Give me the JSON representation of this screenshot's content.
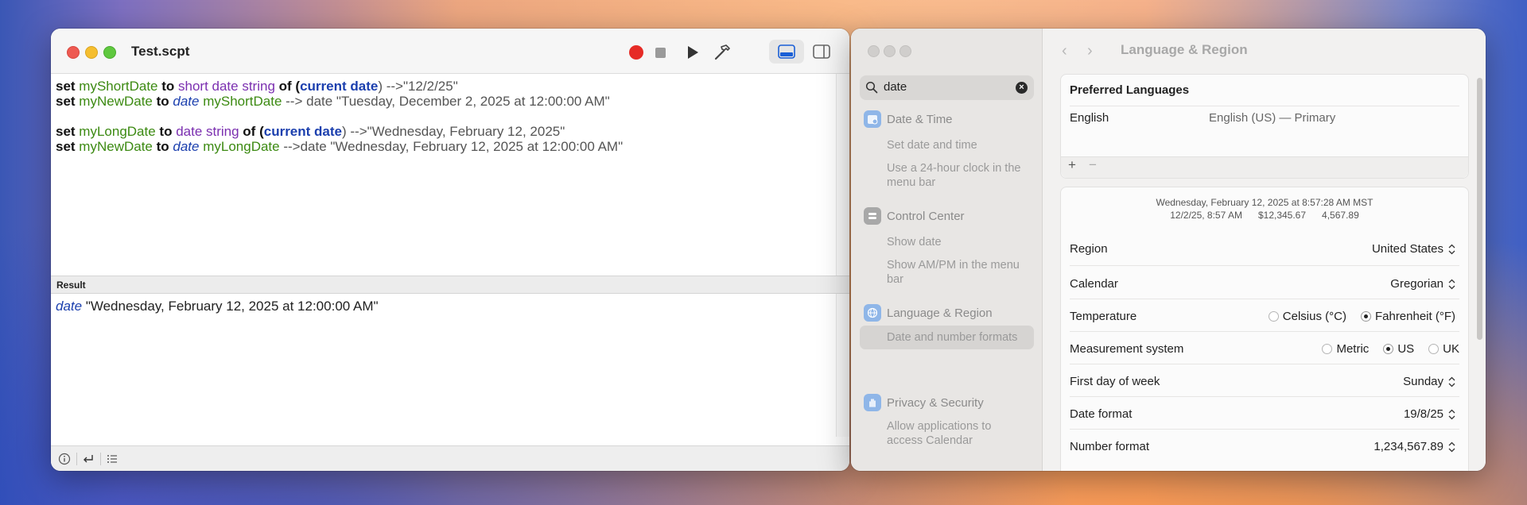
{
  "script_window": {
    "title": "Test.scpt",
    "toolbar": {
      "record": "record-icon",
      "stop": "stop-icon",
      "run": "play-icon",
      "compile": "hammer-icon",
      "view_bottom": "panel-bottom-icon",
      "view_side": "panel-side-icon"
    },
    "code": {
      "l1": {
        "a": "set ",
        "b": "myShortDate",
        "c": " to ",
        "d": "short date string",
        "e": " of (",
        "f": "current date",
        "g": ") -->\"12/2/25\""
      },
      "l2": {
        "a": "set ",
        "b": "myNewDate",
        "c": " to ",
        "d": "date",
        "e": " ",
        "f": "myShortDate",
        "g": " --> date \"Tuesday, December 2, 2025 at 12:00:00 AM\""
      },
      "l3": {
        "a": "set ",
        "b": "myLongDate",
        "c": " to ",
        "d": "date string",
        "e": " of (",
        "f": "current date",
        "g": ") -->\"Wednesday, February 12, 2025\""
      },
      "l4": {
        "a": "set ",
        "b": "myNewDate",
        "c": " to ",
        "d": "date",
        "e": " ",
        "f": "myLongDate",
        "g": " -->date \"Wednesday, February 12, 2025 at 12:00:00 AM\""
      }
    },
    "result_label": "Result",
    "result": {
      "a": "date",
      "b": " \"Wednesday, February 12, 2025 at 12:00:00 AM\""
    }
  },
  "settings_window": {
    "search_value": "date",
    "sidebar": {
      "date_time": {
        "title": "Date & Time",
        "items": [
          "Set date and time",
          "Use a 24-hour clock in the menu bar"
        ]
      },
      "control_center": {
        "title": "Control Center",
        "items": [
          "Show date",
          "Show AM/PM in the menu bar"
        ]
      },
      "language_region": {
        "title": "Language & Region",
        "items": [
          "Date and number formats"
        ]
      },
      "privacy": {
        "title": "Privacy & Security",
        "items": [
          "Allow applications to access Calendar"
        ]
      }
    },
    "page_title": "Language & Region",
    "preferred_languages": {
      "header": "Preferred Languages",
      "language": "English",
      "language_detail": "English (US) — Primary",
      "add": "+",
      "remove": "−"
    },
    "preview": {
      "line1": "Wednesday, February 12, 2025 at 8:57:28 AM MST",
      "line2_a": "12/2/25, 8:57 AM",
      "line2_b": "$12,345.67",
      "line2_c": "4,567.89"
    },
    "rows": {
      "region": {
        "label": "Region",
        "value": "United States"
      },
      "calendar": {
        "label": "Calendar",
        "value": "Gregorian"
      },
      "temperature": {
        "label": "Temperature",
        "opt1": "Celsius (°C)",
        "opt2": "Fahrenheit (°F)",
        "selected": "Fahrenheit (°F)"
      },
      "measurement": {
        "label": "Measurement system",
        "opt1": "Metric",
        "opt2": "US",
        "opt3": "UK",
        "selected": "US"
      },
      "first_day": {
        "label": "First day of week",
        "value": "Sunday"
      },
      "date_format": {
        "label": "Date format",
        "value": "19/8/25"
      },
      "number_format": {
        "label": "Number format",
        "value": "1,234,567.89"
      }
    }
  }
}
